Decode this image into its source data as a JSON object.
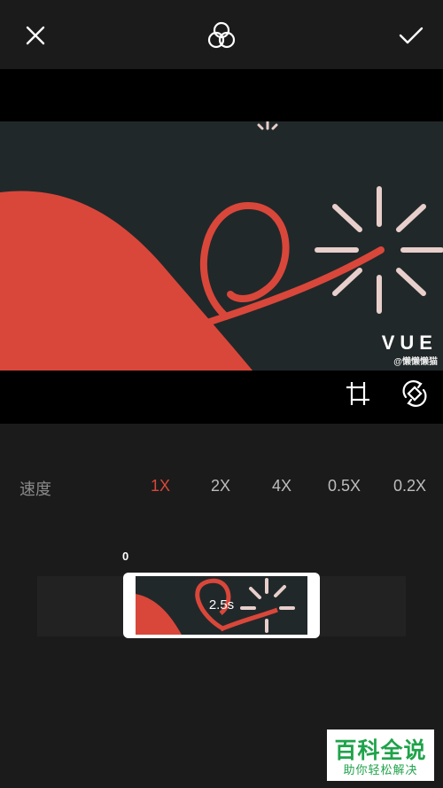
{
  "header": {
    "close_icon": "close-icon",
    "filter_icon": "filter-circles-icon",
    "confirm_icon": "check-icon"
  },
  "preview": {
    "watermark_brand": "VUE",
    "watermark_user": "@懒懒懒猫"
  },
  "tools": {
    "crop_icon": "crop-icon",
    "rotate_icon": "rotate-icon"
  },
  "speed": {
    "label": "速度",
    "options": [
      "1X",
      "2X",
      "4X",
      "0.5X",
      "0.2X"
    ],
    "selected": "1X"
  },
  "timeline": {
    "start_label": "0",
    "clip_duration": "2.5s"
  },
  "logo": {
    "title": "百科全说",
    "subtitle": "助你轻松解决"
  },
  "colors": {
    "accent": "#d9473a",
    "background": "#1b1b1b",
    "brand_green": "#1ea34a"
  }
}
